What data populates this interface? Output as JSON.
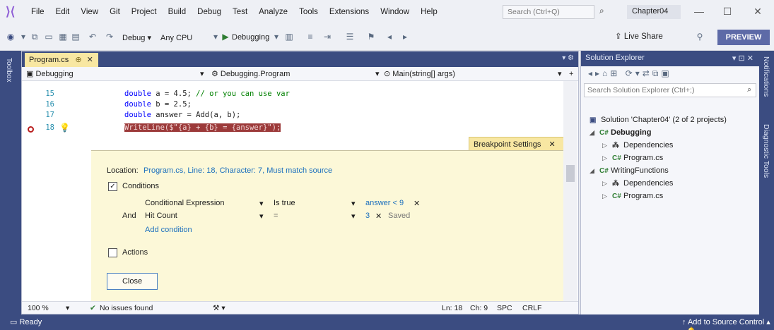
{
  "menubar": {
    "items": [
      "File",
      "Edit",
      "View",
      "Git",
      "Project",
      "Build",
      "Debug",
      "Test",
      "Analyze",
      "Tools",
      "Extensions",
      "Window",
      "Help"
    ],
    "search_placeholder": "Search (Ctrl+Q)",
    "solution_name": "Chapter04"
  },
  "toolbar": {
    "config": "Debug",
    "platform": "Any CPU",
    "start_label": "Debugging",
    "live_share": "Live Share",
    "preview": "PREVIEW"
  },
  "toolbox_label": "Toolbox",
  "right_strip": {
    "notifications": "Notifications",
    "diagnostic": "Diagnostic Tools"
  },
  "editor": {
    "tab_label": "Program.cs",
    "nav_project": "Debugging",
    "nav_class": "Debugging.Program",
    "nav_member": "Main(string[] args)",
    "lines": [
      {
        "num": "15",
        "kw": "double",
        "rest": " a = 4.5; ",
        "comment": "// or you can use var"
      },
      {
        "num": "16",
        "kw": "double",
        "rest": " b = 2.5;",
        "comment": ""
      },
      {
        "num": "17",
        "kw": "double",
        "rest": " answer = Add(a, b);",
        "comment": ""
      },
      {
        "num": "18",
        "kw": "",
        "rest": "WriteLine($\"{a} + {b} = {answer}\");",
        "comment": ""
      }
    ],
    "breakpoint_panel": {
      "title": "Breakpoint Settings",
      "location_label": "Location:",
      "location_value": "Program.cs, Line: 18, Character: 7, Must match source",
      "conditions_label": "Conditions",
      "conditions_checked": true,
      "cond_type": "Conditional Expression",
      "cond_op": "Is true",
      "cond_value": "answer < 9",
      "and_label": "And",
      "hit_type": "Hit Count",
      "hit_op": "=",
      "hit_value": "3",
      "hit_status": "Saved",
      "add_condition": "Add condition",
      "actions_label": "Actions",
      "actions_checked": false,
      "close_label": "Close"
    },
    "status": {
      "zoom": "100 %",
      "issues": "No issues found",
      "line": "Ln: 18",
      "col": "Ch: 9",
      "spc": "SPC",
      "crlf": "CRLF"
    }
  },
  "solution_explorer": {
    "title": "Solution Explorer",
    "search_placeholder": "Search Solution Explorer (Ctrl+;)",
    "solution": "Solution 'Chapter04' (2 of 2 projects)",
    "projects": [
      {
        "name": "Debugging",
        "bold": true,
        "children": [
          "Dependencies",
          "Program.cs"
        ]
      },
      {
        "name": "WritingFunctions",
        "bold": false,
        "children": [
          "Dependencies",
          "Program.cs"
        ]
      }
    ]
  },
  "statusbar": {
    "ready": "Ready",
    "source_control": "Add to Source Control"
  }
}
